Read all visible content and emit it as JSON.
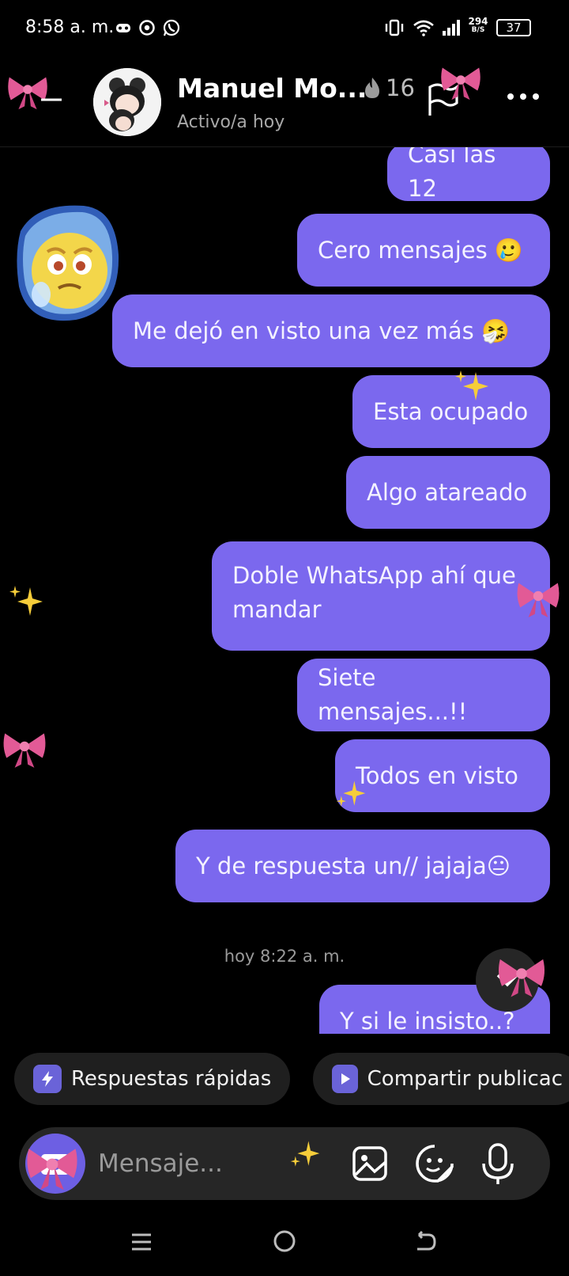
{
  "status_bar": {
    "time": "8:58 a. m.",
    "speed_value": "294",
    "speed_unit": "B/S",
    "battery": "37"
  },
  "header": {
    "title": "Manuel Mo...",
    "subtitle": "Activo/a hoy",
    "streak": "16"
  },
  "messages": [
    {
      "text": "Casi las 12"
    },
    {
      "text": "Cero mensajes 🥲"
    },
    {
      "text": "Me dejó en visto una vez más 🤧"
    },
    {
      "text": "Esta ocupado"
    },
    {
      "text": "Algo atareado"
    },
    {
      "text": "Doble WhatsApp ahí que mandar"
    },
    {
      "text": "Siete mensajes...!!"
    },
    {
      "text": "Todos en visto"
    },
    {
      "text": "Y de respuesta un// jajaja😐"
    },
    {
      "text": "Y si le  insisto..?"
    }
  ],
  "timestamp": "hoy 8:22 a. m.",
  "quick_actions": {
    "quick_replies": "Respuestas rápidas",
    "share_post": "Compartir publicac"
  },
  "composer": {
    "placeholder": "Mensaje..."
  },
  "colors": {
    "bubble": "#7b68ee",
    "background": "#000000",
    "chip": "#1f1f1f"
  }
}
